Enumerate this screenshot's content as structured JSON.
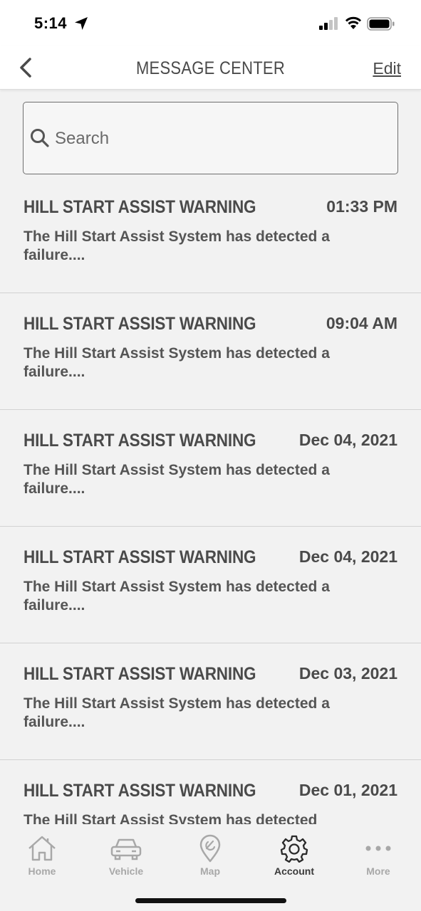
{
  "status_bar": {
    "time": "5:14"
  },
  "nav": {
    "title": "MESSAGE CENTER",
    "edit_label": "Edit"
  },
  "search": {
    "placeholder": "Search"
  },
  "messages": [
    {
      "title": "HILL START ASSIST WARNING",
      "date": "01:33 PM",
      "body": "The Hill Start Assist System has detected a failure...."
    },
    {
      "title": "HILL START ASSIST WARNING",
      "date": "09:04 AM",
      "body": "The Hill Start Assist System has detected a failure...."
    },
    {
      "title": "HILL START ASSIST WARNING",
      "date": "Dec 04, 2021",
      "body": "The Hill Start Assist System has detected a failure...."
    },
    {
      "title": "HILL START ASSIST WARNING",
      "date": "Dec 04, 2021",
      "body": "The Hill Start Assist System has detected a failure...."
    },
    {
      "title": "HILL START ASSIST WARNING",
      "date": "Dec 03, 2021",
      "body": "The Hill Start Assist System has detected a failure...."
    },
    {
      "title": "HILL START ASSIST WARNING",
      "date": "Dec 01, 2021",
      "body": "The Hill Start Assist System has detected"
    }
  ],
  "tabs": [
    {
      "label": "Home",
      "icon": "home-icon"
    },
    {
      "label": "Vehicle",
      "icon": "car-icon"
    },
    {
      "label": "Map",
      "icon": "map-pin-icon"
    },
    {
      "label": "Account",
      "icon": "gear-icon",
      "active": true
    },
    {
      "label": "More",
      "icon": "more-icon"
    }
  ]
}
